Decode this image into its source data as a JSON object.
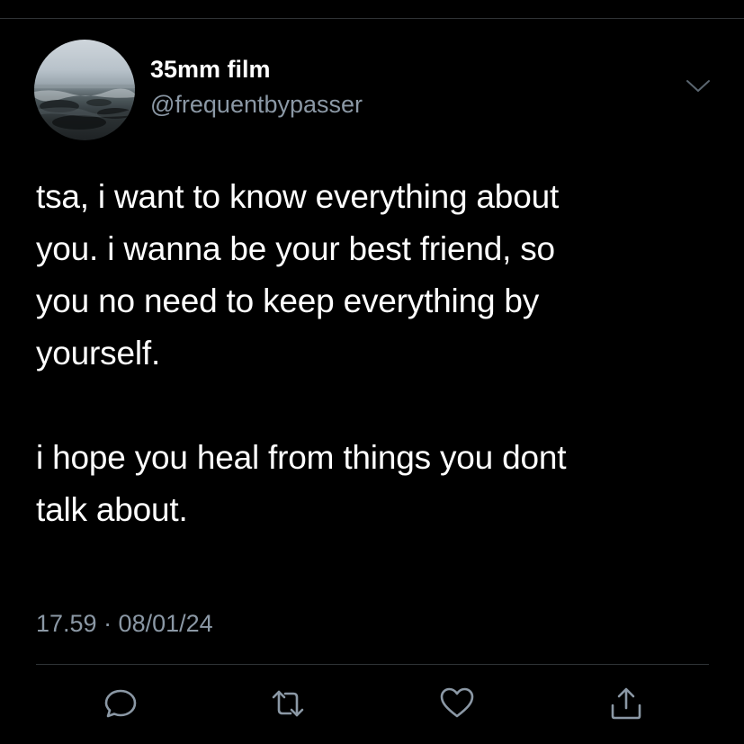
{
  "author": {
    "display_name": "35mm film",
    "handle": "@frequentbypasser"
  },
  "tweet": {
    "text": "tsa, i want to know everything about\nyou. i wanna be your best friend, so\nyou no need to keep everything by\nyourself.\n\ni hope you heal from things you dont\ntalk about.",
    "timestamp": "17.59 · 08/01/24"
  },
  "icons": {
    "more": "chevron-down-icon",
    "reply": "reply-icon",
    "retweet": "retweet-icon",
    "like": "heart-icon",
    "share": "share-icon"
  },
  "colors": {
    "background": "#000000",
    "text": "#ffffff",
    "secondary_text": "#8b98a5",
    "divider": "#2f3336"
  }
}
